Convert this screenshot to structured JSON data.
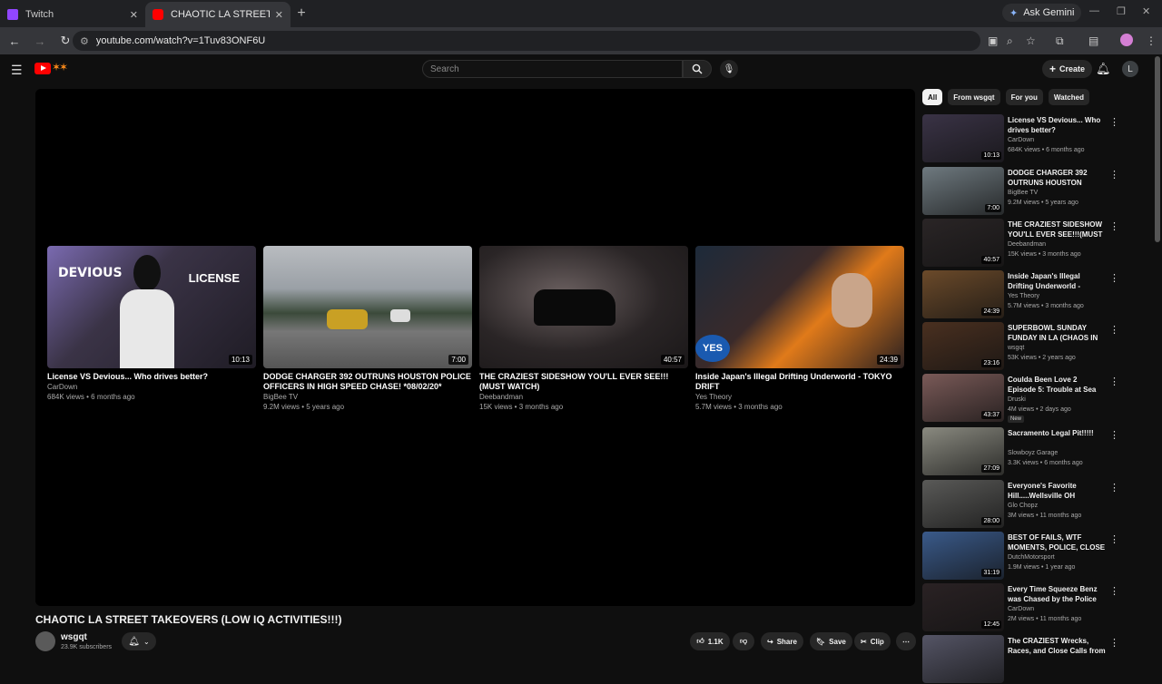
{
  "browser": {
    "tabs": [
      {
        "title": "Twitch",
        "active": false,
        "favicon_color": "#9146ff"
      },
      {
        "title": "CHAOTIC LA STREET TAKEOVERS",
        "active": true,
        "favicon_color": "#ff0000"
      }
    ],
    "url": "youtube.com/watch?v=1Tuv83ONF6U",
    "gemini_label": "Ask Gemini"
  },
  "youtube": {
    "search_placeholder": "Search",
    "create_label": "Create",
    "avatar_letter": "L",
    "player_end_cards": [
      {
        "title": "License VS Devious... Who drives better?",
        "channel": "CarDown",
        "meta": "684K views • 6 months ago",
        "duration": "10:13"
      },
      {
        "title": "DODGE CHARGER 392 OUTRUNS HOUSTON POLICE OFFICERS IN HIGH SPEED CHASE! *08/02/20*",
        "channel": "BigBee TV",
        "meta": "9.2M views • 5 years ago",
        "duration": "7:00"
      },
      {
        "title": "THE CRAZIEST SIDESHOW YOU'LL EVER SEE!!!(MUST WATCH)",
        "channel": "Deebandman",
        "meta": "15K views • 3 months ago",
        "duration": "40:57"
      },
      {
        "title": "Inside Japan's Illegal Drifting Underworld - TOKYO DRIFT",
        "channel": "Yes Theory",
        "meta": "5.7M views • 3 months ago",
        "duration": "24:39"
      }
    ],
    "video": {
      "title": "CHAOTIC LA STREET TAKEOVERS (LOW IQ ACTIVITIES!!!)",
      "channel": "wsgqt",
      "subscribers": "23.9K subscribers",
      "likes": "1.1K",
      "share_label": "Share",
      "save_label": "Save",
      "clip_label": "Clip"
    },
    "chips": [
      "All",
      "From wsgqt",
      "For you",
      "Watched"
    ],
    "recommendations": [
      {
        "title": "License VS Devious... Who drives better?",
        "channel": "CarDown",
        "meta": "684K views • 6 months ago",
        "duration": "10:13",
        "thumb_color": "#3a3346"
      },
      {
        "title": "DODGE CHARGER 392 OUTRUNS HOUSTON POLICE ...",
        "channel": "BigBee TV",
        "meta": "9.2M views • 5 years ago",
        "duration": "7:00",
        "thumb_color": "#6f7a80"
      },
      {
        "title": "THE CRAZIEST SIDESHOW YOU'LL EVER SEE!!!(MUST ...",
        "channel": "Deebandman",
        "meta": "15K views • 3 months ago",
        "duration": "40:57",
        "thumb_color": "#2a2526"
      },
      {
        "title": "Inside Japan's Illegal Drifting Underworld - TOKYO DRIFT",
        "channel": "Yes Theory",
        "meta": "5.7M views • 3 months ago",
        "duration": "24:39",
        "thumb_color": "#6b4a2a"
      },
      {
        "title": "SUPERBOWL SUNDAY FUNDAY IN LA (CHAOS IN THE ...",
        "channel": "wsgqt",
        "meta": "53K views • 2 years ago",
        "duration": "23:16",
        "thumb_color": "#4a3020"
      },
      {
        "title": "Coulda Been Love 2 Episode 5: Trouble at Sea",
        "channel": "Druski",
        "meta": "4M views • 2 days ago",
        "duration": "43:37",
        "thumb_color": "#7a5a58",
        "badge": "New"
      },
      {
        "title": "Sacramento Legal Pit!!!!!",
        "channel": "Slowboyz Garage",
        "meta": "3.3K views • 6 months ago",
        "duration": "27:09",
        "thumb_color": "#8a8a80"
      },
      {
        "title": "Everyone's Favorite Hill.....Wellsville OH",
        "channel": "Glo Chopz",
        "meta": "3M views • 11 months ago",
        "duration": "28:00",
        "thumb_color": "#5a5a58"
      },
      {
        "title": "BEST OF FAILS, WTF MOMENTS, POLICE, CLOSE ...",
        "channel": "DutchMotorsport",
        "meta": "1.9M views • 1 year ago",
        "duration": "31:19",
        "thumb_color": "#3a5a8a"
      },
      {
        "title": "Every Time Squeeze Benz was Chased by the Police",
        "channel": "CarDown",
        "meta": "2M views • 11 months ago",
        "duration": "12:45",
        "thumb_color": "#2a2224"
      },
      {
        "title": "The CRAZIEST Wrecks, Races, and Close Calls from No-Prep",
        "channel": "",
        "meta": "",
        "duration": "",
        "thumb_color": "#556"
      }
    ]
  }
}
